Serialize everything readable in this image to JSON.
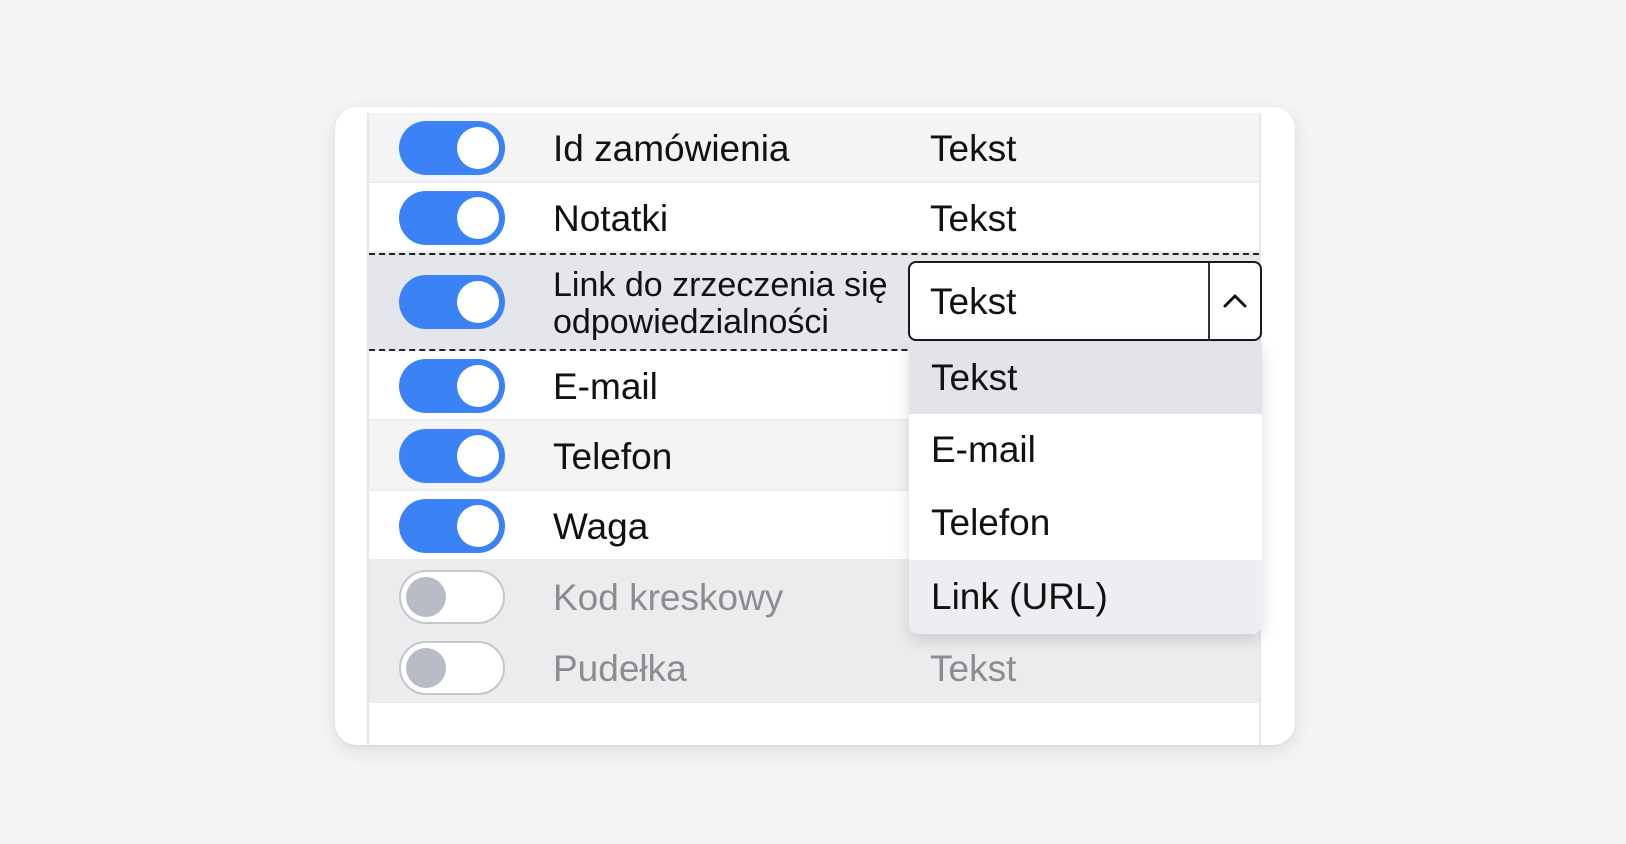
{
  "rows": [
    {
      "label": "Id zamówienia",
      "type": "Tekst",
      "enabled": true
    },
    {
      "label": "Notatki",
      "type": "Tekst",
      "enabled": true
    },
    {
      "label": "Link do zrzeczenia się odpowiedzialności",
      "type": "Tekst",
      "enabled": true
    },
    {
      "label": "E-mail",
      "type": "",
      "enabled": true
    },
    {
      "label": "Telefon",
      "type": "",
      "enabled": true
    },
    {
      "label": "Waga",
      "type": "",
      "enabled": true
    },
    {
      "label": "Kod kreskowy",
      "type": "",
      "enabled": false
    },
    {
      "label": "Pudełka",
      "type": "Tekst",
      "enabled": false
    }
  ],
  "type_select": {
    "value": "Tekst",
    "icon": "chevron-up-icon",
    "options": [
      "Tekst",
      "E-mail",
      "Telefon",
      "Link (URL)"
    ]
  },
  "colors": {
    "toggle_on": "#3b82f6",
    "toggle_off_knob": "#b7bcc6"
  }
}
